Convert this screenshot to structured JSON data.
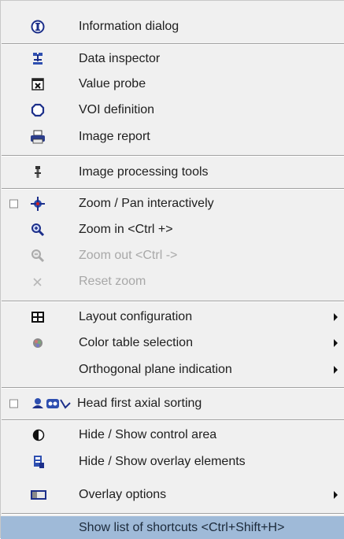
{
  "menu": {
    "items": [
      {
        "label": "Information dialog",
        "icon": "info-icon"
      },
      {
        "label": "Data inspector",
        "icon": "data-inspector-icon"
      },
      {
        "label": "Value probe",
        "icon": "value-probe-icon"
      },
      {
        "label": "VOI definition",
        "icon": "voi-definition-icon"
      },
      {
        "label": "Image report",
        "icon": "printer-icon"
      },
      {
        "label": "Image processing tools",
        "icon": "processing-tools-icon"
      },
      {
        "label": "Zoom / Pan interactively",
        "icon": "zoom-pan-icon",
        "checkbox": true
      },
      {
        "label": "Zoom in  <Ctrl +>",
        "icon": "zoom-in-icon"
      },
      {
        "label": "Zoom out  <Ctrl ->",
        "icon": "zoom-out-icon",
        "disabled": true
      },
      {
        "label": "Reset zoom",
        "icon": "reset-zoom-icon",
        "disabled": true
      },
      {
        "label": "Layout configuration",
        "icon": "layout-icon",
        "submenu": true
      },
      {
        "label": "Color table selection",
        "icon": "color-table-icon",
        "submenu": true
      },
      {
        "label": "Orthogonal plane indication",
        "submenu": true
      },
      {
        "label": "Head first axial sorting",
        "icon": "head-first-icon",
        "checkbox": true
      },
      {
        "label": "Hide / Show control area",
        "icon": "half-circle-icon"
      },
      {
        "label": "Hide / Show overlay elements",
        "icon": "overlay-elements-icon"
      },
      {
        "label": "Overlay options",
        "icon": "overlay-options-icon",
        "submenu": true
      },
      {
        "label": "Show list of shortcuts <Ctrl+Shift+H>",
        "selected": true
      }
    ]
  },
  "colors": {
    "menu_bg": "#f0f0f0",
    "highlight": "#9fbad8",
    "disabled_text": "#a8a8a8"
  }
}
